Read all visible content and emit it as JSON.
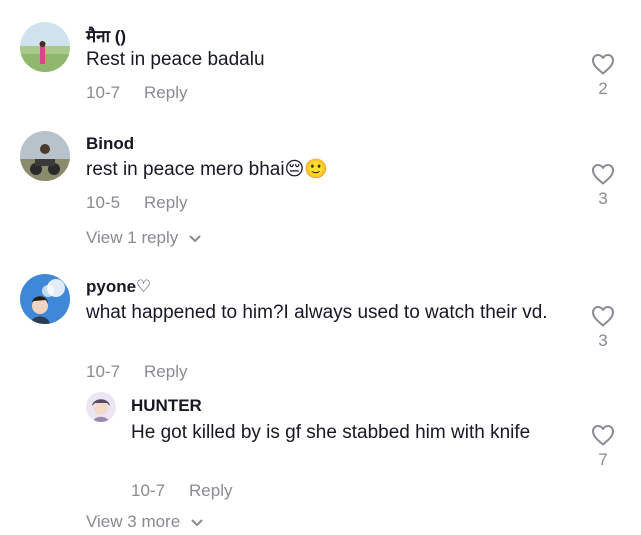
{
  "comments": [
    {
      "username": "मैना ()",
      "text": "Rest in peace badalu",
      "date": "10-7",
      "reply_label": "Reply",
      "likes": "2",
      "avatar": "landscape-photo-avatar"
    },
    {
      "username": "Binod",
      "text": "rest in peace mero bhai😔🙂",
      "date": "10-5",
      "reply_label": "Reply",
      "likes": "3",
      "avatar": "motorbike-photo-avatar",
      "view_replies_label": "View 1 reply"
    },
    {
      "username": "pyone♡",
      "text": "what happened to him?I always used to watch their vd.",
      "date": "10-7",
      "reply_label": "Reply",
      "likes": "3",
      "avatar": "sky-photo-avatar",
      "reply": {
        "username": "HUNTER",
        "text": "He got killed by is gf she stabbed him with knife",
        "date": "10-7",
        "reply_label": "Reply",
        "likes": "7",
        "avatar": "anime-avatar"
      },
      "view_more_label": "View 3 more"
    }
  ],
  "icons": {
    "like": "heart-outline-icon",
    "expand": "chevron-down-icon"
  },
  "colors": {
    "text": "#161823",
    "secondary": "#8a8b91",
    "background": "#ffffff"
  }
}
